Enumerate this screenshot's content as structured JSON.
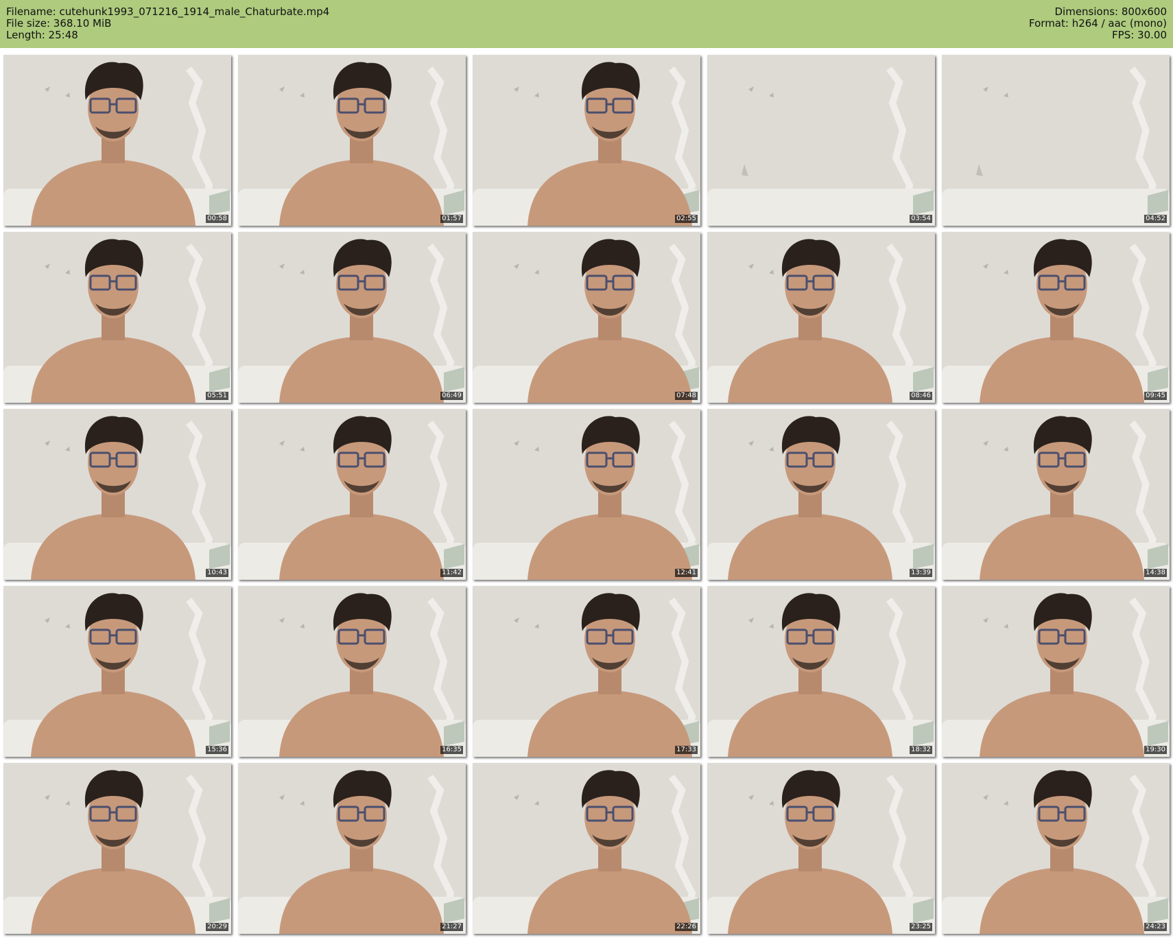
{
  "header": {
    "filename_line": "Filename: cutehunk1993_071216_1914_male_Chaturbate.mp4",
    "filesize_line": "File size: 368.10 MiB",
    "length_line": "Length: 25:48",
    "dimensions_line": "Dimensions: 800x600",
    "format_line": "Format: h264 / aac (mono)",
    "fps_line": "FPS: 30.00"
  },
  "thumbnails": [
    {
      "timestamp": "00:58",
      "shows_person": true
    },
    {
      "timestamp": "01:57",
      "shows_person": true
    },
    {
      "timestamp": "02:55",
      "shows_person": true
    },
    {
      "timestamp": "03:54",
      "shows_person": false
    },
    {
      "timestamp": "04:52",
      "shows_person": false
    },
    {
      "timestamp": "05:51",
      "shows_person": true
    },
    {
      "timestamp": "06:49",
      "shows_person": true
    },
    {
      "timestamp": "07:48",
      "shows_person": true
    },
    {
      "timestamp": "08:46",
      "shows_person": true
    },
    {
      "timestamp": "09:45",
      "shows_person": true
    },
    {
      "timestamp": "10:43",
      "shows_person": true
    },
    {
      "timestamp": "11:42",
      "shows_person": true
    },
    {
      "timestamp": "12:41",
      "shows_person": true
    },
    {
      "timestamp": "13:39",
      "shows_person": true
    },
    {
      "timestamp": "14:38",
      "shows_person": true
    },
    {
      "timestamp": "15:36",
      "shows_person": true
    },
    {
      "timestamp": "16:35",
      "shows_person": true
    },
    {
      "timestamp": "17:33",
      "shows_person": true
    },
    {
      "timestamp": "18:32",
      "shows_person": true
    },
    {
      "timestamp": "19:30",
      "shows_person": true
    },
    {
      "timestamp": "20:29",
      "shows_person": true
    },
    {
      "timestamp": "21:27",
      "shows_person": true
    },
    {
      "timestamp": "22:26",
      "shows_person": true
    },
    {
      "timestamp": "23:25",
      "shows_person": true
    },
    {
      "timestamp": "24:23",
      "shows_person": true
    }
  ],
  "colors": {
    "header_background": "#aecb7e",
    "wall": "#dedbd5",
    "skin": "#c7997b",
    "hair": "#2a211c",
    "couch": "#ecebe6"
  }
}
